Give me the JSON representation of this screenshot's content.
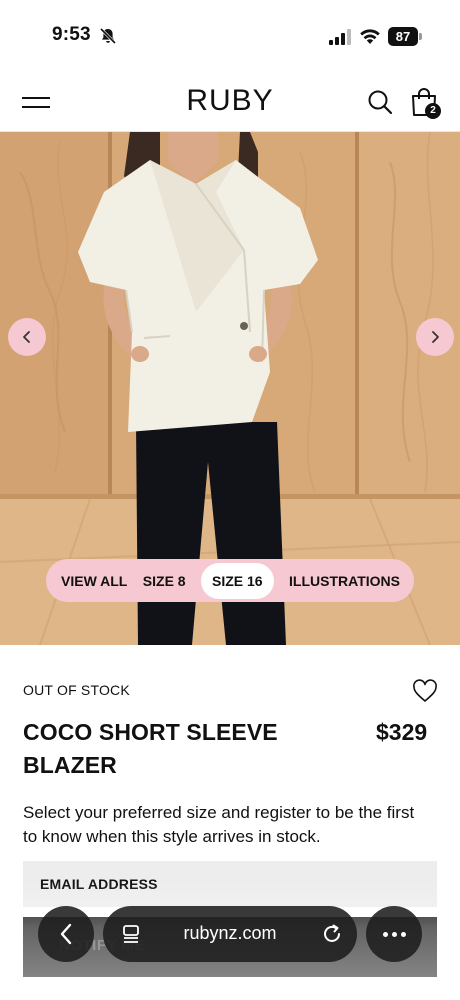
{
  "status_bar": {
    "time": "9:53",
    "battery": "87"
  },
  "header": {
    "brand": "RUBY",
    "bag_count": "2"
  },
  "gallery": {
    "filters": [
      {
        "label": "VIEW ALL",
        "active": false
      },
      {
        "label": "SIZE 8",
        "active": false
      },
      {
        "label": "SIZE 16",
        "active": true
      },
      {
        "label": "ILLUSTRATIONS",
        "active": false
      }
    ]
  },
  "product": {
    "stock_status": "OUT OF STOCK",
    "title": "COCO SHORT SLEEVE BLAZER",
    "price": "$329",
    "note": "Select your preferred size and register to be the first to know when this style arrives in stock.",
    "email_label": "EMAIL ADDRESS",
    "notify_label": "NOTIFY ME"
  },
  "browser": {
    "url": "rubynz.com"
  },
  "colors": {
    "accent_pink": "#f6c8d1",
    "field_gray": "#ededed",
    "button_black": "#111111"
  },
  "icons": [
    "bell-slash-icon",
    "signal-icon",
    "wifi-icon",
    "menu-icon",
    "search-icon",
    "bag-icon",
    "chevron-left-icon",
    "chevron-right-icon",
    "heart-icon",
    "tabs-icon",
    "reload-icon",
    "more-icon"
  ]
}
